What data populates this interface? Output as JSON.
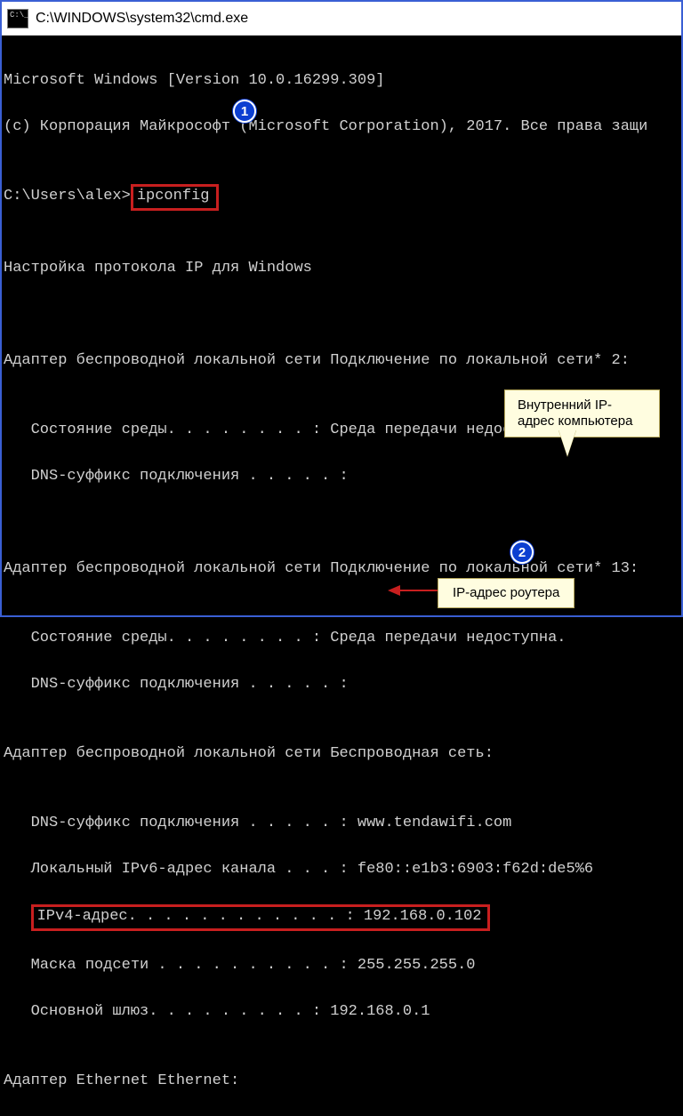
{
  "window": {
    "title": "C:\\WINDOWS\\system32\\cmd.exe"
  },
  "lines": {
    "l1": "Microsoft Windows [Version 10.0.16299.309]",
    "l2": "(c) Корпорация Майкрософт (Microsoft Corporation), 2017. Все права защи",
    "blank": "",
    "promptPrefix": "C:\\Users\\alex>",
    "command": "ipconfig",
    "cfgTitle": "Настройка протокола IP для Windows",
    "adapter2": "Адаптер беспроводной локальной сети Подключение по локальной сети* 2:",
    "media1": "   Состояние среды. . . . . . . . : Среда передачи недоступна.",
    "dns1": "   DNS-суффикс подключения . . . . . :",
    "adapter13": "Адаптер беспроводной локальной сети Подключение по локальной сети* 13:",
    "media2": "   Состояние среды. . . . . . . . : Среда передачи недоступна.",
    "dns2": "   DNS-суффикс подключения . . . . . :",
    "adapterW": "Адаптер беспроводной локальной сети Беспроводная сеть:",
    "wdns": "   DNS-суффикс подключения . . . . . : www.tendawifi.com",
    "wipv6": "   Локальный IPv6-адрес канала . . . : fe80::e1b3:6903:f62d:de5%6",
    "wipv4": "IPv4-адрес. . . . . . . . . . . . : 192.168.0.102",
    "wmask": "   Маска подсети . . . . . . . . . . : 255.255.255.0",
    "wgw": "   Основной шлюз. . . . . . . . . : 192.168.0.1",
    "eth": "Адаптер Ethernet Ethernet:"
  },
  "badges": {
    "one": "1",
    "two": "2"
  },
  "callouts": {
    "innerIp": "Внутренний IP-адрес компьютера",
    "routerIp": "IP-адрес роутера"
  }
}
